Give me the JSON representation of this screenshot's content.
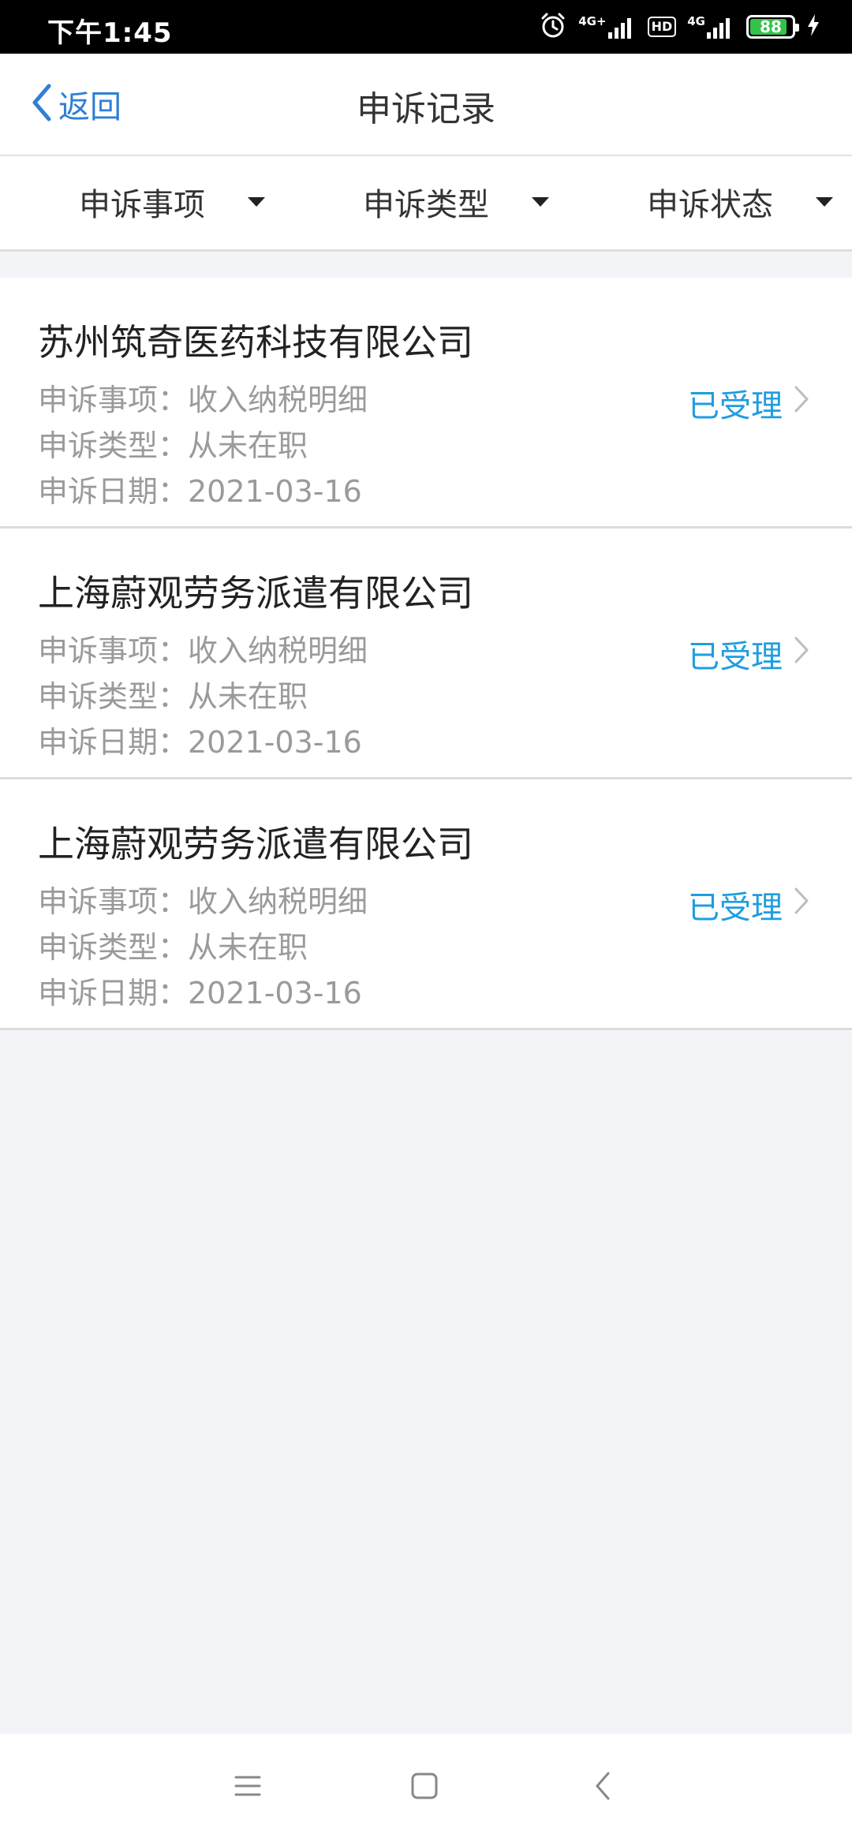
{
  "status_bar": {
    "time": "下午1:45",
    "signal1_label": "4G+",
    "hd_label": "HD",
    "signal2_label": "4G",
    "battery_level": "88",
    "battery_fraction": 0.88
  },
  "nav": {
    "back_label": "返回",
    "title": "申诉记录"
  },
  "filters": [
    {
      "label": "申诉事项"
    },
    {
      "label": "申诉类型"
    },
    {
      "label": "申诉状态"
    }
  ],
  "records": [
    {
      "company": "苏州筑奇医药科技有限公司",
      "item": "申诉事项：收入纳税明细",
      "type": "申诉类型：从未在职",
      "date": "申诉日期：2021-03-16",
      "status": "已受理"
    },
    {
      "company": "上海蔚观劳务派遣有限公司",
      "item": "申诉事项：收入纳税明细",
      "type": "申诉类型：从未在职",
      "date": "申诉日期：2021-03-16",
      "status": "已受理"
    },
    {
      "company": "上海蔚观劳务派遣有限公司",
      "item": "申诉事项：收入纳税明细",
      "type": "申诉类型：从未在职",
      "date": "申诉日期：2021-03-16",
      "status": "已受理"
    }
  ],
  "colors": {
    "accent_blue": "#2f7fd6",
    "status_blue": "#1f9de0",
    "background": "#f3f4f7"
  },
  "icons": {
    "back": "chevron-left-icon",
    "status_chevron": "chevron-right-icon",
    "filter_caret": "caret-down-icon",
    "menu": "menu-icon",
    "home": "home-square-icon",
    "back_key": "back-triangle-icon"
  }
}
